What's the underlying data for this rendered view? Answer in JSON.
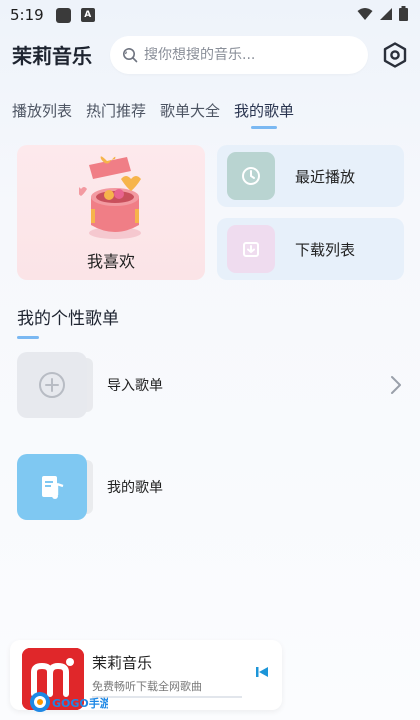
{
  "status": {
    "time": "5:19",
    "notif_letter": "A"
  },
  "header": {
    "app_title": "茉莉音乐"
  },
  "search": {
    "placeholder": "搜你想搜的音乐..."
  },
  "tabs": [
    {
      "label": "播放列表"
    },
    {
      "label": "热门推荐"
    },
    {
      "label": "歌单大全"
    },
    {
      "label": "我的歌单",
      "active": true
    }
  ],
  "cards": {
    "favorites": {
      "label": "我喜欢"
    },
    "recent": {
      "label": "最近播放",
      "icon": "clock-icon"
    },
    "download": {
      "label": "下载列表",
      "icon": "download-icon"
    }
  },
  "my_playlists": {
    "title": "我的个性歌单",
    "items": [
      {
        "label": "导入歌单",
        "icon": "plus-circle-icon"
      },
      {
        "label": "我的歌单",
        "icon": "music-file-icon"
      }
    ]
  },
  "player": {
    "title": "茉莉音乐",
    "subtitle": "免费畅听下载全网歌曲"
  },
  "watermark": {
    "text": "GOGO手游网"
  },
  "colors": {
    "accent": "#7ab8f2",
    "fav_bg": "#fde9ec",
    "quick_bg": "#e7f0fa",
    "player_cover": "#e0272a"
  }
}
